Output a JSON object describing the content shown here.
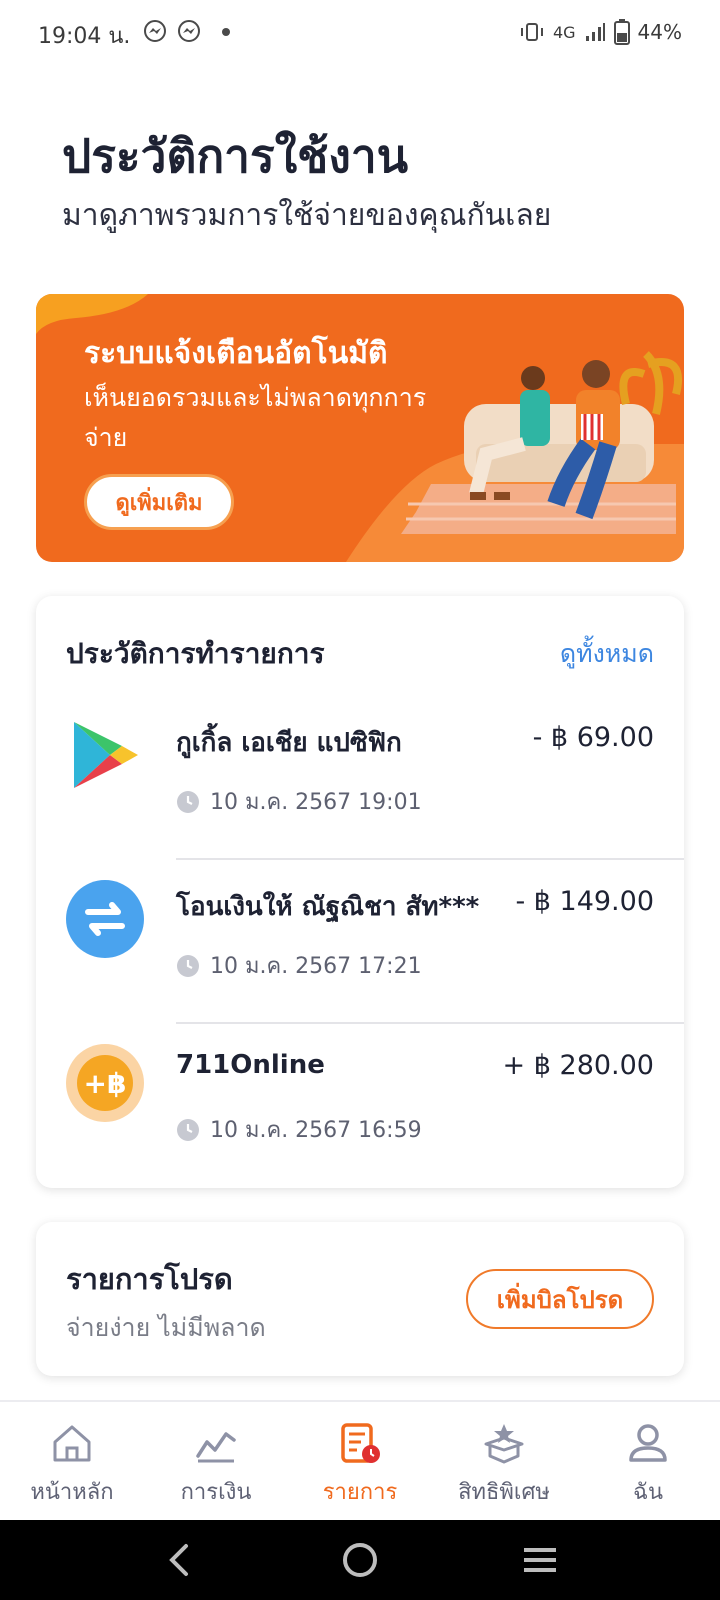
{
  "status_bar": {
    "time": "19:04 น.",
    "network": "4G",
    "battery": "44%"
  },
  "header": {
    "title": "ประวัติการใช้งาน",
    "subtitle": "มาดูภาพรวมการใช้จ่ายของคุณกันเลย"
  },
  "banner": {
    "title": "ระบบแจ้งเตือนอัตโนมัติ",
    "description": "เห็นยอดรวมและไม่พลาดทุกการจ่าย",
    "button_label": "ดูเพิ่มเติม"
  },
  "transactions": {
    "title": "ประวัติการทำรายการ",
    "see_all": "ดูทั้งหมด",
    "items": [
      {
        "name": "กูเกิ้ล เอเชีย แปซิฟิก",
        "amount": "- ฿ 69.00",
        "time": "10 ม.ค. 2567 19:01",
        "icon": "google-play-icon"
      },
      {
        "name": "โอนเงินให้  ณัฐณิชา สัท***",
        "amount": "- ฿ 149.00",
        "time": "10 ม.ค. 2567 17:21",
        "icon": "transfer-icon"
      },
      {
        "name": "711Online",
        "amount": "+ ฿ 280.00",
        "time": "10 ม.ค. 2567 16:59",
        "icon": "baht-coin-icon"
      }
    ]
  },
  "favorite_bills": {
    "title": "รายการโปรด",
    "subtitle": "จ่ายง่าย ไม่มีพลาด",
    "button_label": "เพิ่มบิลโปรด"
  },
  "bottom_nav": {
    "items": [
      {
        "label": "หน้าหลัก",
        "icon": "home-icon"
      },
      {
        "label": "การเงิน",
        "icon": "finance-icon"
      },
      {
        "label": "รายการ",
        "icon": "transactions-icon",
        "active": true
      },
      {
        "label": "สิทธิพิเศษ",
        "icon": "privileges-icon"
      },
      {
        "label": "ฉัน",
        "icon": "profile-icon"
      }
    ]
  },
  "colors": {
    "accent": "#f06a1e",
    "link": "#3d86e0",
    "text": "#1e2233"
  }
}
